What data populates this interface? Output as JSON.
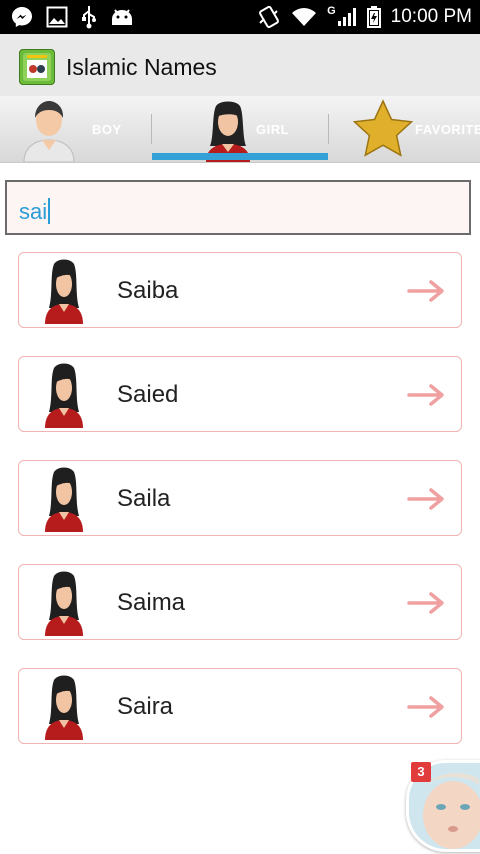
{
  "status_bar": {
    "time": "10:00 PM",
    "network": "G",
    "icons": [
      "messenger-icon",
      "image-icon",
      "usb-icon",
      "android-icon",
      "vibrate-icon",
      "wifi-icon",
      "signal-icon",
      "battery-icon"
    ]
  },
  "app_bar": {
    "title": "Islamic Names"
  },
  "tabs": [
    {
      "label": "BOY",
      "selected": false
    },
    {
      "label": "GIRL",
      "selected": true
    },
    {
      "label": "FAVORITE",
      "selected": false
    }
  ],
  "search": {
    "value": "sai"
  },
  "names": [
    {
      "name": "Saiba"
    },
    {
      "name": "Saied"
    },
    {
      "name": "Saila"
    },
    {
      "name": "Saima"
    },
    {
      "name": "Saira"
    }
  ],
  "chat_head": {
    "badge_count": "3"
  },
  "colors": {
    "accent": "#33a1d8",
    "border": "#efb3b3",
    "arrow": "#f0a0a0",
    "search_text": "#2b9dd6"
  }
}
